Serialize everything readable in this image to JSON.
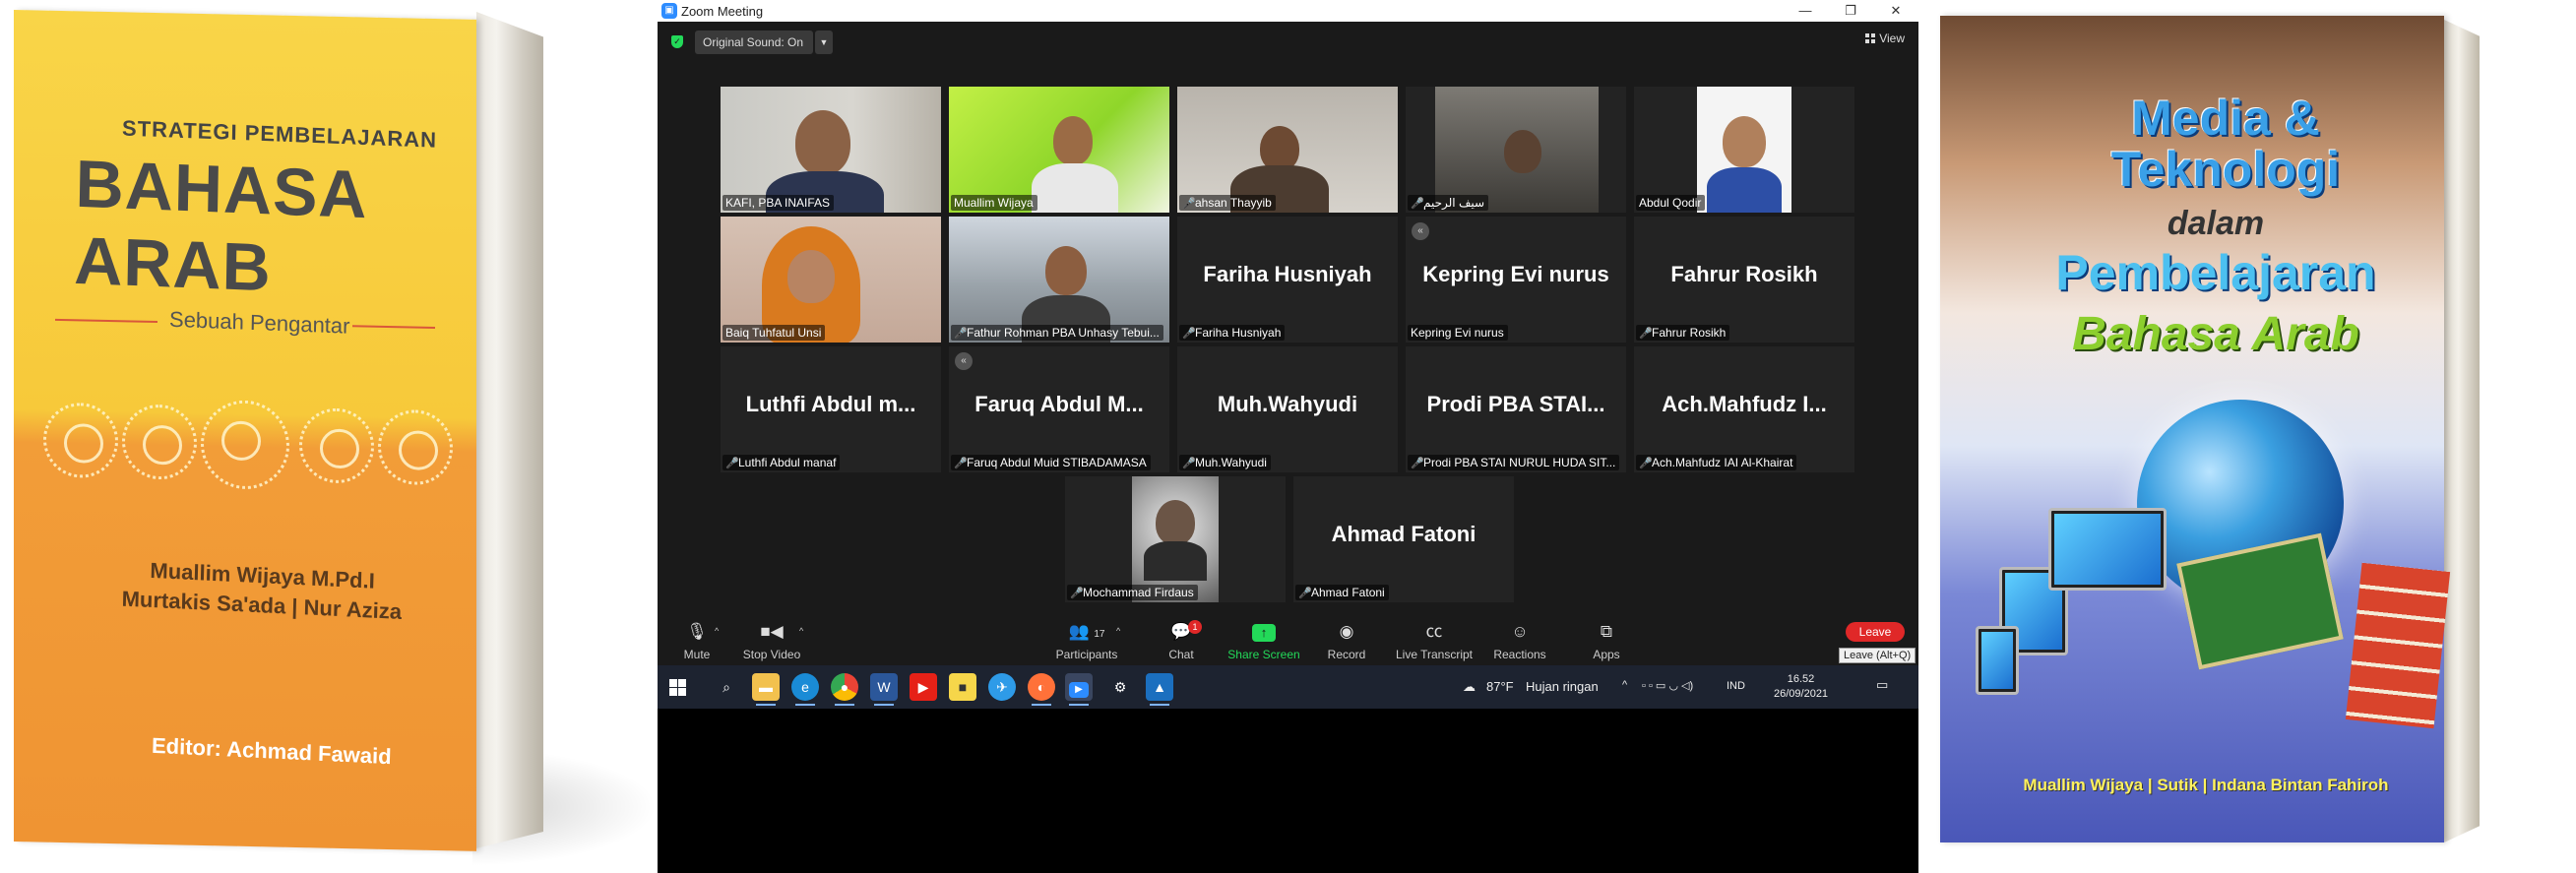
{
  "left_book": {
    "subtitle": "STRATEGI PEMBELAJARAN",
    "title": "BAHASA ARAB",
    "tagline": "Sebuah Pengantar",
    "authors": [
      "Muallim Wijaya M.Pd.I",
      "Murtakis Sa'ada | Nur Aziza"
    ],
    "editor": "Editor: Achmad Fawaid",
    "colors": {
      "top": "#f9d548",
      "bottom": "#ef9433"
    }
  },
  "zoom": {
    "window_title": "Zoom Meeting",
    "window_buttons": [
      "minimize-icon",
      "maximize-icon",
      "close-icon"
    ],
    "original_sound": "Original Sound: On",
    "view_label": "View",
    "participants": [
      {
        "name": "KAFI, PBA INAIFAS",
        "muted": false,
        "video": true,
        "active": true
      },
      {
        "name": "Muallim Wijaya",
        "muted": false,
        "video": true,
        "active": false
      },
      {
        "name": "ahsan Thayyib",
        "muted": true,
        "video": true,
        "active": false
      },
      {
        "name": "سيف الرحيم",
        "muted": true,
        "video": true,
        "active": false
      },
      {
        "name": "Abdul Qodir",
        "muted": false,
        "video": true,
        "active": false
      },
      {
        "name": "Baiq Tuhfatul Unsi",
        "muted": false,
        "video": true,
        "active": false
      },
      {
        "name": "Fathur Rohman PBA Unhasy Tebui...",
        "muted": true,
        "video": true,
        "active": false
      },
      {
        "name": "Fariha Husniyah",
        "display": "Fariha Husniyah",
        "muted": true,
        "video": false
      },
      {
        "name": "Kepring Evi nurus",
        "display": "Kepring Evi nurus",
        "muted": false,
        "video": false
      },
      {
        "name": "Fahrur Rosikh",
        "display": "Fahrur Rosikh",
        "muted": true,
        "video": false
      },
      {
        "name": "Luthfi Abdul manaf",
        "display": "Luthfi Abdul m...",
        "muted": true,
        "video": false
      },
      {
        "name": "Faruq Abdul Muid STIBADAMASA",
        "display": "Faruq Abdul M...",
        "muted": true,
        "video": false
      },
      {
        "name": "Muh.Wahyudi",
        "display": "Muh.Wahyudi",
        "muted": true,
        "video": false
      },
      {
        "name": "Prodi PBA STAI NURUL HUDA SIT...",
        "display": "Prodi PBA STAI...",
        "muted": true,
        "video": false
      },
      {
        "name": "Ach.Mahfudz IAI Al-Khairat",
        "display": "Ach.Mahfudz I...",
        "muted": true,
        "video": false
      },
      {
        "name": "Mochammad Firdaus",
        "muted": true,
        "video": true
      },
      {
        "name": "Ahmad Fatoni",
        "display": "Ahmad Fatoni",
        "muted": true,
        "video": false
      }
    ],
    "toolbar": {
      "mute": "Mute",
      "stop_video": "Stop Video",
      "participants": "Participants",
      "participants_count": "17",
      "chat": "Chat",
      "chat_badge": "1",
      "share_screen": "Share Screen",
      "record": "Record",
      "live_transcript": "Live Transcript",
      "reactions": "Reactions",
      "apps": "Apps",
      "leave": "Leave",
      "leave_tooltip": "Leave (Alt+Q)"
    },
    "colors": {
      "share": "#23d959",
      "leave": "#e02828",
      "active_speaker": "#f2e36b"
    }
  },
  "taskbar": {
    "icons": [
      "windows-icon",
      "search-icon",
      "file-explorer-icon",
      "edge-icon",
      "chrome-icon",
      "word-icon",
      "youtube-icon",
      "sticky-notes-icon",
      "app-icon",
      "firefox-icon",
      "zoom-icon",
      "settings-icon",
      "photos-icon"
    ],
    "weather_temp": "87°F",
    "weather_text": "Hujan ringan",
    "lang": "IND",
    "time": "16.52",
    "date": "26/09/2021"
  },
  "right_book": {
    "title_1": "Media &",
    "title_2": "Teknologi",
    "title_3": "dalam",
    "title_4": "Pembelajaran",
    "title_5": "Bahasa Arab",
    "authors": "Muallim Wijaya | Sutik | Indana Bintan Fahiroh"
  }
}
